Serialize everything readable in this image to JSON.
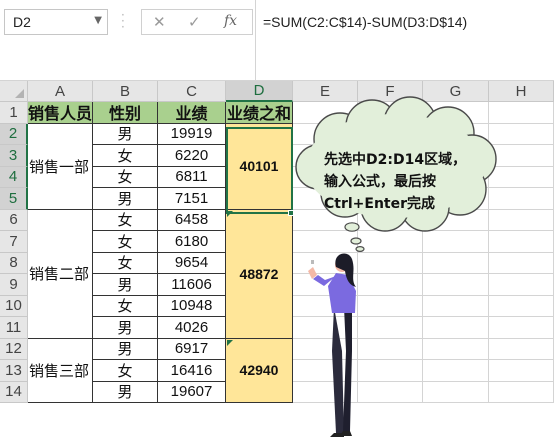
{
  "formula_bar": {
    "name_box": "D2",
    "cancel_icon": "✕",
    "enter_icon": "✓",
    "fx_label": "fx",
    "formula": "=SUM(C2:C$14)-SUM(D3:D$14)"
  },
  "sheet": {
    "columns": [
      "A",
      "B",
      "C",
      "D",
      "E",
      "F",
      "G",
      "H"
    ],
    "rows": [
      "1",
      "2",
      "3",
      "4",
      "5",
      "6",
      "7",
      "8",
      "9",
      "10",
      "11",
      "12",
      "13",
      "14"
    ],
    "selected_column": "D",
    "selected_rows": [
      "2",
      "3",
      "4",
      "5"
    ],
    "headers": [
      "销售人员",
      "性别",
      "业绩",
      "业绩之和"
    ],
    "groups": [
      {
        "name": "销售一部",
        "sum": "40101",
        "rows": [
          {
            "gender": "男",
            "sales": "19919"
          },
          {
            "gender": "女",
            "sales": "6220"
          },
          {
            "gender": "女",
            "sales": "6811"
          },
          {
            "gender": "男",
            "sales": "7151"
          }
        ]
      },
      {
        "name": "销售二部",
        "sum": "48872",
        "rows": [
          {
            "gender": "女",
            "sales": "6458"
          },
          {
            "gender": "女",
            "sales": "6180"
          },
          {
            "gender": "女",
            "sales": "9654"
          },
          {
            "gender": "男",
            "sales": "11606"
          },
          {
            "gender": "女",
            "sales": "10948"
          },
          {
            "gender": "男",
            "sales": "4026"
          }
        ]
      },
      {
        "name": "销售三部",
        "sum": "42940",
        "rows": [
          {
            "gender": "男",
            "sales": "6917"
          },
          {
            "gender": "女",
            "sales": "16416"
          },
          {
            "gender": "男",
            "sales": "19607"
          }
        ]
      }
    ]
  },
  "callout": {
    "lines": [
      "先选中D2:D14区域，",
      "输入公式，最后按",
      "Ctrl+Enter完成"
    ]
  },
  "colors": {
    "header_fill": "#a9d08e",
    "merged_fill": "#ffe699",
    "bubble_fill": "#e2efda",
    "selection": "#217346"
  }
}
